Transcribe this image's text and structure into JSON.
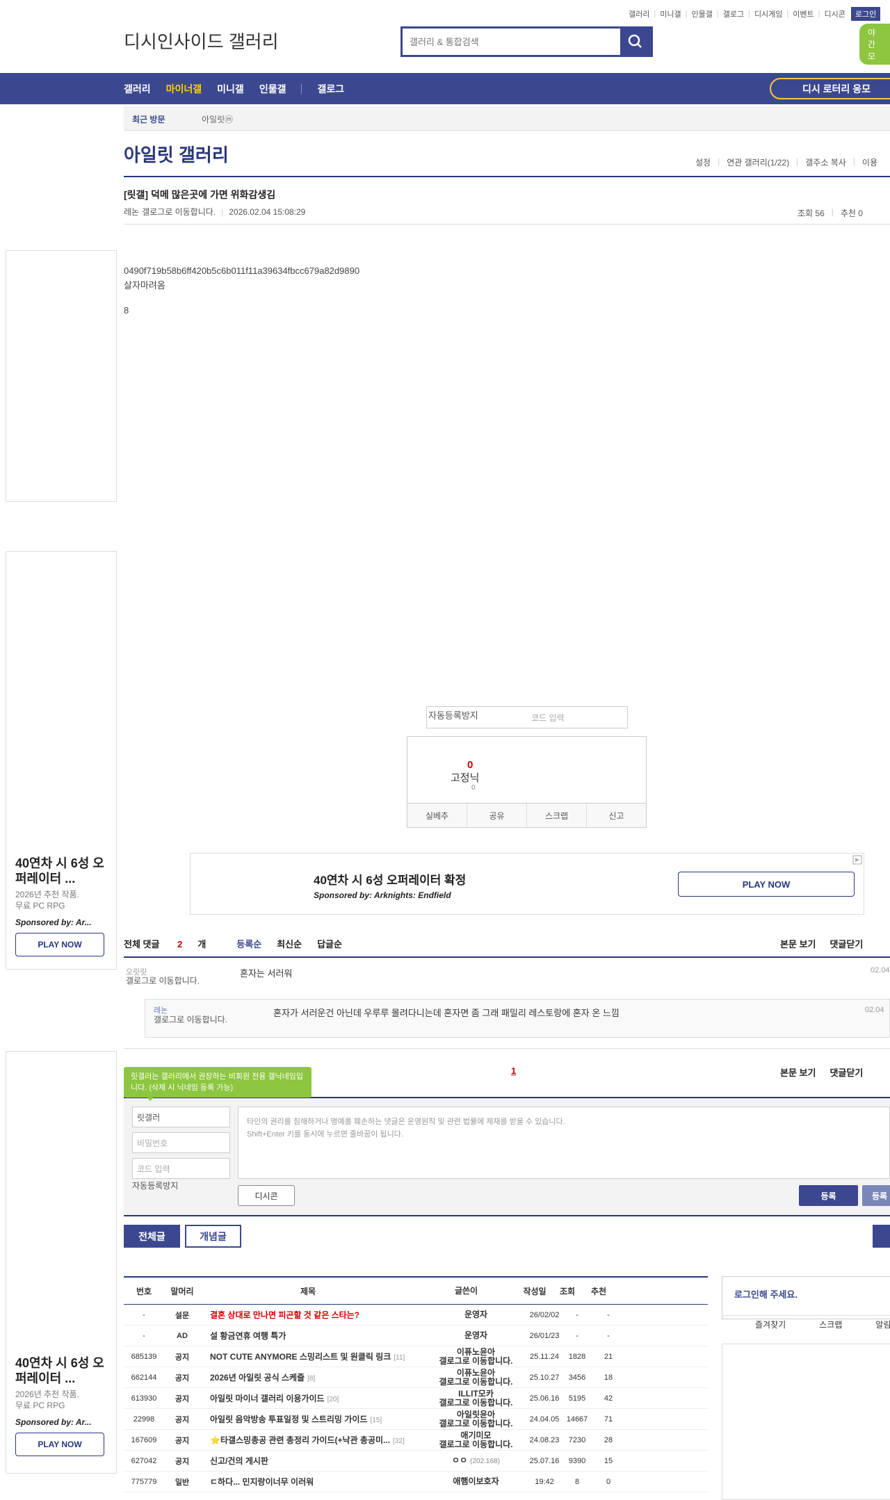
{
  "top_links": [
    "갤러리",
    "미니갤",
    "인물갤",
    "갤로그",
    "디시게임",
    "이벤트",
    "디시콘"
  ],
  "login_label": "로그인",
  "night_label": "야간 모",
  "logo_alt": "디시인사이드 갤러리",
  "search": {
    "placeholder": "갤러리 & 통합검색"
  },
  "nav": {
    "items": [
      "갤러리",
      "마이너갤",
      "미니갤",
      "인물갤",
      "갤로그"
    ],
    "active": "마이너갤",
    "lottery": "디시 로터리 응모"
  },
  "recent": {
    "label": "최근 방문",
    "item": "아일릿ⓜ"
  },
  "gallery": {
    "title": "아일릿 갤러리",
    "tools": [
      "설정",
      "연관 갤러리(1/22)",
      "갤주소 복사",
      "이용"
    ]
  },
  "post": {
    "title": "[릿갤] 덕메 많은곳에 가면 위화감생김",
    "author": "레논",
    "author_icon_alt": "갤로그로 이동합니다.",
    "datetime": "2026.02.04 15:08:29",
    "views": "조회 56",
    "recommends": "추천 0",
    "image1_alt": "0490f719b58b6ff420b5c6b011f11a39634fbcc679a82d9890",
    "text1": "살자마려옴",
    "image2_alt": "8"
  },
  "captcha": {
    "img_alt": "자동등록방지",
    "placeholder": "코드 입력"
  },
  "recommend": {
    "count": "0",
    "fixed_alt": "고정닉",
    "fixed_count": "0",
    "buttons": [
      "실베추",
      "공유",
      "스크랩",
      "신고"
    ]
  },
  "ad": {
    "title": "40연차 시 6성 오퍼레이터 확정",
    "sponsor": "Sponsored by: Arknights: Endfield",
    "play": "PLAY NOW",
    "side_title": "40연차 시 6성 오퍼레이터 ...",
    "side_sub1": "2026년 추천 작품.",
    "side_sub2": "무료 PC RPG",
    "side_sponsor": "Sponsored by: Ar..."
  },
  "comments": {
    "header_prefix": "전체 댓글",
    "count": "2",
    "header_suffix": "개",
    "sorts": [
      "등록순",
      "최신순",
      "답글순"
    ],
    "view_body": "본문 보기",
    "close": "댓글닫기",
    "list": [
      {
        "name": "오릿릿",
        "icon_alt": "갤로그로 이동합니다.",
        "text": "혼자는 서러워",
        "date": "02.04"
      },
      {
        "name": "레논",
        "icon_alt": "갤로그로 이동합니다.",
        "text": "혼자가 서러운건 아닌데 우루루 몰려다니는데 혼자면 좀 그래 패밀리 레스토랑에 혼자 온 느낌",
        "date": "02.04"
      }
    ],
    "page": "1"
  },
  "write": {
    "tooltip": "릿갤러는 갤러리에서 권장하는 비회원 전용 갤닉네임입니다. (삭제 시 닉네임 등록 가능)",
    "nickname": "릿갤러",
    "password_placeholder": "비밀번호",
    "code_placeholder": "코드 입력",
    "captcha_alt": "자동등록방지",
    "notice1": "타인의 권리를 침해하거나 명예를 훼손하는 댓글은 운영원칙 및 관련 법률에 제재를 받을 수 있습니다.",
    "notice2": "Shift+Enter 키를 동시에 누르면 줄바꿈이 됩니다.",
    "dccon": "디시콘",
    "submit": "등록",
    "submit2": "등록"
  },
  "list_tabs": {
    "all": "전체글",
    "best": "개념글"
  },
  "list": {
    "headers": [
      "번호",
      "말머리",
      "제목",
      "글쓴이",
      "작성일",
      "조회",
      "추천"
    ],
    "rows": [
      {
        "no": "-",
        "head": "설문",
        "title": "결혼 상대로 만나면 피곤할 것 같은 스타는?",
        "cnt": "",
        "writer": "운영자",
        "writer_sub": "",
        "date": "26/02/02",
        "views": "-",
        "rec": "-",
        "red": true
      },
      {
        "no": "-",
        "head": "AD",
        "title": "설 황금연휴 여행 특가",
        "cnt": "",
        "writer": "운영자",
        "writer_sub": "",
        "date": "26/01/23",
        "views": "-",
        "rec": "-",
        "red": false
      },
      {
        "no": "685139",
        "head": "공지",
        "title": "NOT CUTE ANYMORE 스밍리스트 및 원클릭 링크",
        "cnt": "[11]",
        "writer": "이퓨노윤아",
        "writer_sub": "갤로그로 이동합니다.",
        "date": "25.11.24",
        "views": "1828",
        "rec": "21",
        "red": false
      },
      {
        "no": "662144",
        "head": "공지",
        "title": "2026년 아일릿 공식 스케줄",
        "cnt": "[8]",
        "writer": "이퓨노윤아",
        "writer_sub": "갤로그로 이동합니다.",
        "date": "25.10.27",
        "views": "3456",
        "rec": "18",
        "red": false
      },
      {
        "no": "613930",
        "head": "공지",
        "title": "아일릿 마이너 갤러리 이용가이드",
        "cnt": "[20]",
        "writer": "ILLIT모카",
        "writer_sub": "갤로그로 이동합니다.",
        "date": "25.06.16",
        "views": "5195",
        "rec": "42",
        "red": false
      },
      {
        "no": "22998",
        "head": "공지",
        "title": "아일릿 음악방송 투표일정 및 스트리밍 가이드",
        "cnt": "[15]",
        "writer": "아일릿윤아",
        "writer_sub": "갤로그로 이동합니다.",
        "date": "24.04.05",
        "views": "14667",
        "rec": "71",
        "red": false
      },
      {
        "no": "167609",
        "head": "공지",
        "title": "⭐타갤스밍총공 관련 총정리 가이드(+낙관 총공미...",
        "cnt": "[32]",
        "writer": "애기미모",
        "writer_sub": "갤로그로 이동합니다.",
        "date": "24.08.23",
        "views": "7230",
        "rec": "28",
        "red": false
      },
      {
        "no": "627042",
        "head": "공지",
        "title": "신고/건의 게시판",
        "cnt": "",
        "writer": "ㅇㅇ",
        "writer_sub": "(202.168)",
        "date": "25.07.16",
        "views": "9390",
        "rec": "15",
        "red": false
      },
      {
        "no": "775779",
        "head": "일반",
        "title": "ㄷ하다... 민지랑이너무 이러워",
        "cnt": "",
        "writer": "애햄이보호자",
        "writer_sub": "",
        "date": "19:42",
        "views": "8",
        "rec": "0",
        "red": false
      }
    ]
  },
  "login_box": {
    "title": "로그인해 주세요.",
    "links": [
      "즐겨찾기",
      "스크랩",
      "알림"
    ]
  }
}
